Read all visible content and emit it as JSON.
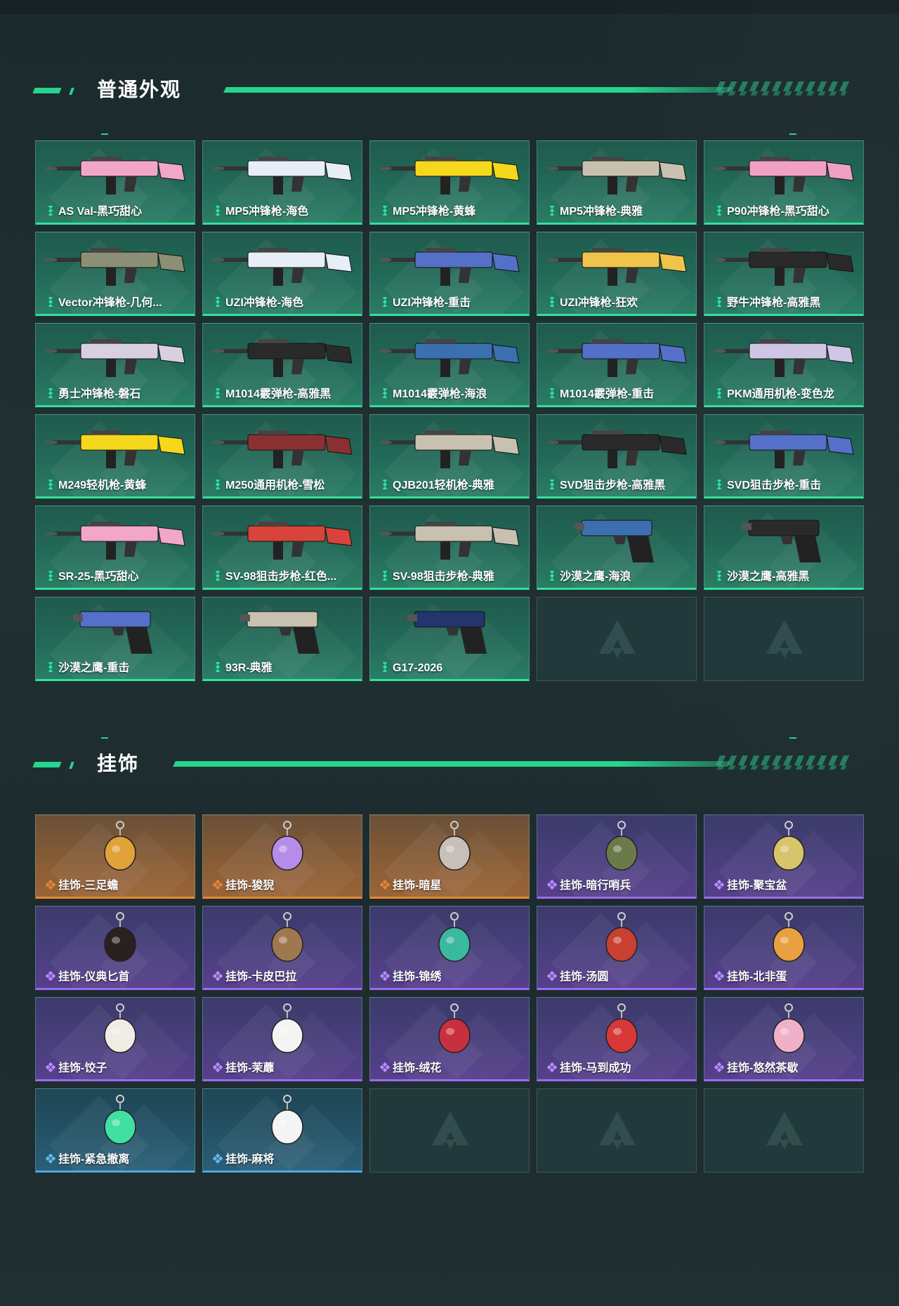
{
  "sections": {
    "skins": {
      "title": "普通外观",
      "items": [
        {
          "label": "AS Val-黑巧甜心",
          "icon": "pink-rifle-icon",
          "color": "#f2a6c9"
        },
        {
          "label": "MP5冲锋枪-海色",
          "icon": "white-blue-smg-icon",
          "color": "#e8eef8"
        },
        {
          "label": "MP5冲锋枪-黄蜂",
          "icon": "yellow-smg-icon",
          "color": "#f5d71b"
        },
        {
          "label": "MP5冲锋枪-典雅",
          "icon": "tan-smg-icon",
          "color": "#c9c1b0"
        },
        {
          "label": "P90冲锋枪-黑巧甜心",
          "icon": "pink-p90-icon",
          "color": "#f0a0c4"
        },
        {
          "label": "Vector冲锋枪-几何...",
          "icon": "camo-vector-icon",
          "color": "#8b8f74"
        },
        {
          "label": "UZI冲锋枪-海色",
          "icon": "white-blue-uzi-icon",
          "color": "#e8eef8"
        },
        {
          "label": "UZI冲锋枪-重击",
          "icon": "blue-white-uzi-icon",
          "color": "#5570c8"
        },
        {
          "label": "UZI冲锋枪-狂欢",
          "icon": "graffiti-uzi-icon",
          "color": "#f0c44a"
        },
        {
          "label": "野牛冲锋枪-高雅黑",
          "icon": "black-bizon-icon",
          "color": "#2a2a2a"
        },
        {
          "label": "勇士冲锋枪-磐石",
          "icon": "marble-smg-icon",
          "color": "#d8d0e0"
        },
        {
          "label": "M1014霰弹枪-高雅黑",
          "icon": "black-shotgun-icon",
          "color": "#2a2a2a"
        },
        {
          "label": "M1014霰弹枪-海浪",
          "icon": "wave-shotgun-icon",
          "color": "#3b6fb0"
        },
        {
          "label": "M1014霰弹枪-重击",
          "icon": "blue-white-shotgun-icon",
          "color": "#5570c8"
        },
        {
          "label": "PKM通用机枪-变色龙",
          "icon": "chameleon-mg-icon",
          "color": "#cfc6e6"
        },
        {
          "label": "M249轻机枪-黄蜂",
          "icon": "yellow-lmg-icon",
          "color": "#f5d71b"
        },
        {
          "label": "M250通用机枪-雪松",
          "icon": "red-mg-icon",
          "color": "#8a3030"
        },
        {
          "label": "QJB201轻机枪-典雅",
          "icon": "tan-lmg-icon",
          "color": "#c9c1b0"
        },
        {
          "label": "SVD狙击步枪-高雅黑",
          "icon": "black-svd-icon",
          "color": "#2a2a2a"
        },
        {
          "label": "SVD狙击步枪-重击",
          "icon": "blue-white-svd-icon",
          "color": "#5570c8"
        },
        {
          "label": "SR-25-黑巧甜心",
          "icon": "pink-sr25-icon",
          "color": "#f2a6c9"
        },
        {
          "label": "SV-98狙击步枪-红色...",
          "icon": "red-sniper-icon",
          "color": "#d8433b"
        },
        {
          "label": "SV-98狙击步枪-典雅",
          "icon": "tan-sniper-icon",
          "color": "#c9c1b0"
        },
        {
          "label": "沙漠之鹰-海浪",
          "icon": "wave-pistol-icon",
          "color": "#3b6fb0"
        },
        {
          "label": "沙漠之鹰-高雅黑",
          "icon": "black-pistol-icon",
          "color": "#2a2a2a"
        },
        {
          "label": "沙漠之鹰-重击",
          "icon": "blue-white-pistol-icon",
          "color": "#5570c8"
        },
        {
          "label": "93R-典雅",
          "icon": "tan-pistol-icon",
          "color": "#c9c1b0"
        },
        {
          "label": "G17-2026",
          "icon": "navy-pistol-icon",
          "color": "#22356e"
        }
      ],
      "empty_slots": 2
    },
    "charms": {
      "title": "挂饰",
      "items": [
        {
          "label": "挂饰-三足蟾",
          "rarity": "orange",
          "icon": "golden-toad-charm-icon",
          "color": "#e0a33a"
        },
        {
          "label": "挂饰-狻猊",
          "rarity": "orange",
          "icon": "lion-charm-icon",
          "color": "#b78ce8"
        },
        {
          "label": "挂饰-暗星",
          "rarity": "orange",
          "icon": "dark-star-charm-icon",
          "color": "#c8c0b8"
        },
        {
          "label": "挂饰-暗行哨兵",
          "rarity": "purple",
          "icon": "sentry-charm-icon",
          "color": "#6b7a4a"
        },
        {
          "label": "挂饰-聚宝盆",
          "rarity": "purple",
          "icon": "treasure-bowl-charm-icon",
          "color": "#d8c46a"
        },
        {
          "label": "挂饰-仪典匕首",
          "rarity": "purple",
          "icon": "dagger-charm-icon",
          "color": "#2a2020"
        },
        {
          "label": "挂饰-卡皮巴拉",
          "rarity": "purple",
          "icon": "capybara-charm-icon",
          "color": "#a07850"
        },
        {
          "label": "挂饰-锦绣",
          "rarity": "purple",
          "icon": "butterfly-charm-icon",
          "color": "#3ab8a0"
        },
        {
          "label": "挂饰-汤圆",
          "rarity": "purple",
          "icon": "dumpling-bowl-charm-icon",
          "color": "#c84030"
        },
        {
          "label": "挂饰-北非蛋",
          "rarity": "purple",
          "icon": "shakshuka-charm-icon",
          "color": "#e8a040"
        },
        {
          "label": "挂饰-饺子",
          "rarity": "purple",
          "icon": "dumpling-plate-charm-icon",
          "color": "#f0ece4"
        },
        {
          "label": "挂饰-茉蘼",
          "rarity": "purple",
          "icon": "flower-charm-icon",
          "color": "#f4f4f4"
        },
        {
          "label": "挂饰-绒花",
          "rarity": "purple",
          "icon": "rose-charm-icon",
          "color": "#c83040"
        },
        {
          "label": "挂饰-马到成功",
          "rarity": "purple",
          "icon": "red-horse-charm-icon",
          "color": "#d83838"
        },
        {
          "label": "挂饰-悠然茶歇",
          "rarity": "purple",
          "icon": "cupcake-charm-icon",
          "color": "#f0b0c8"
        },
        {
          "label": "挂饰-紧急撤离",
          "rarity": "blue",
          "icon": "exit-sign-charm-icon",
          "color": "#40e0a0"
        },
        {
          "label": "挂饰-麻将",
          "rarity": "blue",
          "icon": "mahjong-tile-charm-icon",
          "color": "#f4f4f4"
        }
      ],
      "empty_slots": 3
    }
  },
  "colors": {
    "accent": "#27d48e",
    "rarity_green": "#2fe39a",
    "rarity_orange": "#e8853a",
    "rarity_purple": "#9a6cf0",
    "rarity_blue": "#4ea8e6"
  }
}
